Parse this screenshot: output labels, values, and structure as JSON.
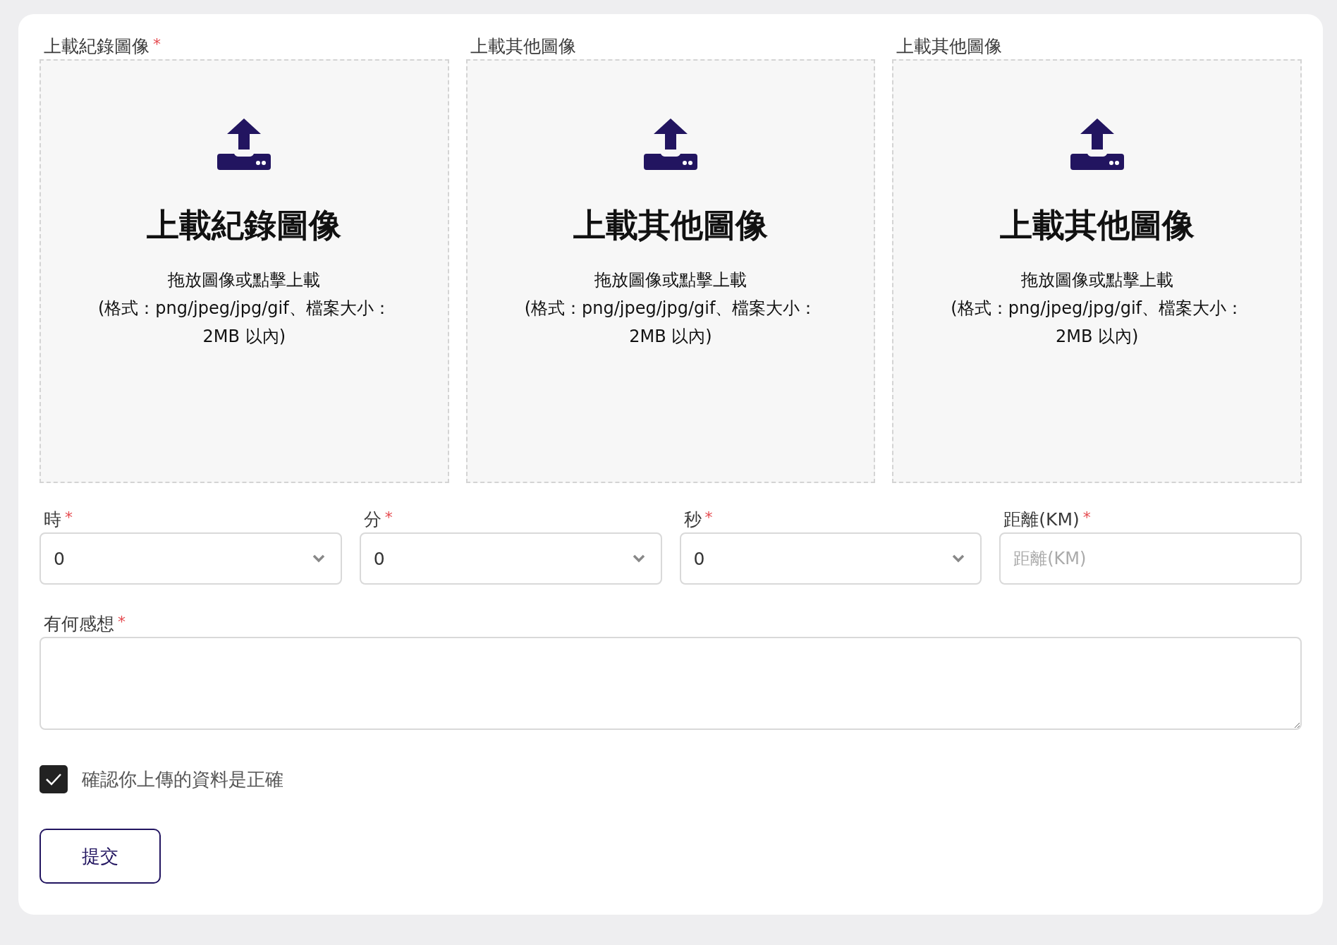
{
  "uploads": [
    {
      "label": "上載紀錄圖像",
      "mark": "*",
      "title": "上載紀錄圖像",
      "hint": "拖放圖像或點擊上載",
      "format": "(格式：png/jpeg/jpg/gif、檔案大小：",
      "size": "2MB 以內)"
    },
    {
      "label": "上載其他圖像",
      "title": "上載其他圖像",
      "hint": "拖放圖像或點擊上載",
      "format": "(格式：png/jpeg/jpg/gif、檔案大小：",
      "size": "2MB 以內)"
    },
    {
      "label": "上載其他圖像",
      "title": "上載其他圖像",
      "hint": "拖放圖像或點擊上載",
      "format": "(格式：png/jpeg/jpg/gif、檔案大小：",
      "size": "2MB 以內)"
    }
  ],
  "fields": [
    {
      "kind": "select",
      "label": "時",
      "mark": "*",
      "value": "0"
    },
    {
      "kind": "select",
      "label": "分",
      "mark": "*",
      "value": "0"
    },
    {
      "kind": "select",
      "label": "秒",
      "mark": "*",
      "value": "0"
    },
    {
      "kind": "input",
      "label": "距離(KM)",
      "mark": "*",
      "placeholder": "距離(KM)"
    }
  ],
  "comment": {
    "label": "有何感想",
    "mark": "*"
  },
  "confirm": {
    "label": "確認你上傳的資料是正確",
    "checked": true
  },
  "submit": "提交"
}
